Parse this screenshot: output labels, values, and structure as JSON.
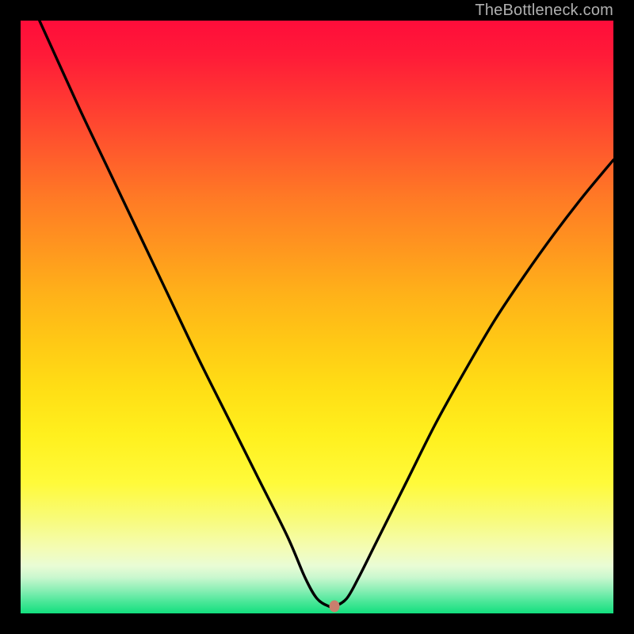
{
  "watermark": "TheBottleneck.com",
  "chart_data": {
    "type": "line",
    "title": "",
    "xlabel": "",
    "ylabel": "",
    "xlim": [
      0,
      100
    ],
    "ylim": [
      0,
      100
    ],
    "grid": false,
    "legend": false,
    "series": [
      {
        "name": "bottleneck-curve",
        "x": [
          0,
          5,
          10,
          15,
          20,
          25,
          30,
          35,
          40,
          45,
          48,
          50,
          52,
          53,
          55,
          57,
          60,
          65,
          70,
          75,
          80,
          85,
          90,
          95,
          100
        ],
        "y": [
          107,
          96,
          85,
          74.5,
          64,
          53.5,
          43,
          33,
          23,
          13,
          6,
          2.5,
          1.2,
          1.2,
          2.5,
          6,
          12,
          22,
          32,
          41,
          49.5,
          57,
          64,
          70.5,
          76.5
        ]
      }
    ],
    "marker": {
      "x": 53,
      "y": 1.2,
      "color": "#c97f6e"
    },
    "background_gradient": {
      "orientation": "vertical",
      "stops": [
        {
          "pos": 0.0,
          "color": "#ff0d3a"
        },
        {
          "pos": 0.5,
          "color": "#ffc815"
        },
        {
          "pos": 0.8,
          "color": "#fffa3a"
        },
        {
          "pos": 1.0,
          "color": "#12df7e"
        }
      ]
    }
  }
}
